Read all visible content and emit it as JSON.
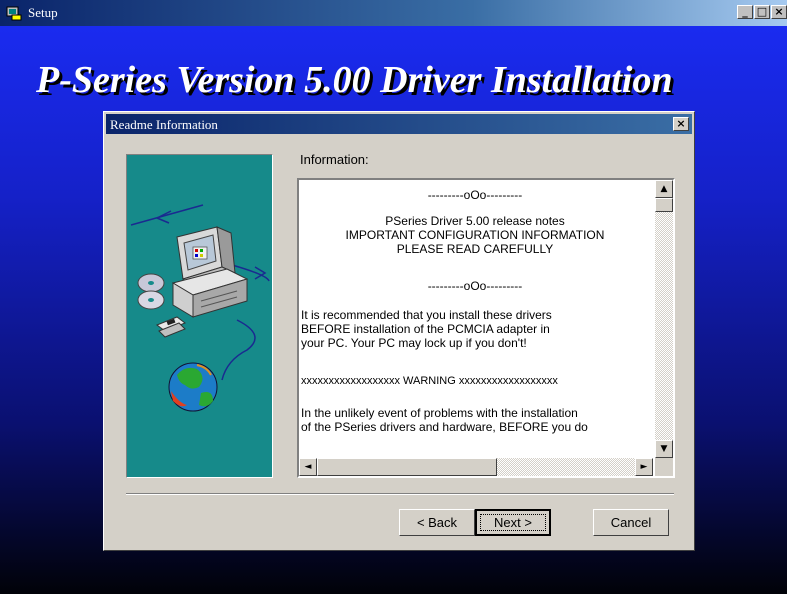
{
  "window": {
    "title": "Setup",
    "minimize_glyph": "_",
    "maximize_glyph": "□",
    "close_glyph": "×"
  },
  "banner_title": "P-Series Version 5.00 Driver Installation",
  "dialog": {
    "title": "Readme Information",
    "close_glyph": "×",
    "info_label": "Information:",
    "readme_lines": [
      "---------oOo---------",
      "PSeries Driver 5.00 release notes",
      "IMPORTANT CONFIGURATION INFORMATION",
      "PLEASE READ CAREFULLY",
      "---------oOo---------",
      "It is recommended that you install these drivers",
      "BEFORE installation of the PCMCIA adapter in",
      "your PC. Your PC may lock up if you don't!",
      "xxxxxxxxxxxxxxxxxx  WARNING  xxxxxxxxxxxxxxxxxx",
      "In the unlikely event of problems with the installation",
      "of the PSeries drivers and hardware, BEFORE you do"
    ],
    "scroll_up": "▲",
    "scroll_down": "▼",
    "scroll_left": "◄",
    "scroll_right": "►",
    "buttons": {
      "back": "< Back",
      "next": "Next >",
      "cancel": "Cancel"
    }
  },
  "icons": {
    "app": "setup-app-icon",
    "illustration": "computer-cd-globe-illustration"
  }
}
